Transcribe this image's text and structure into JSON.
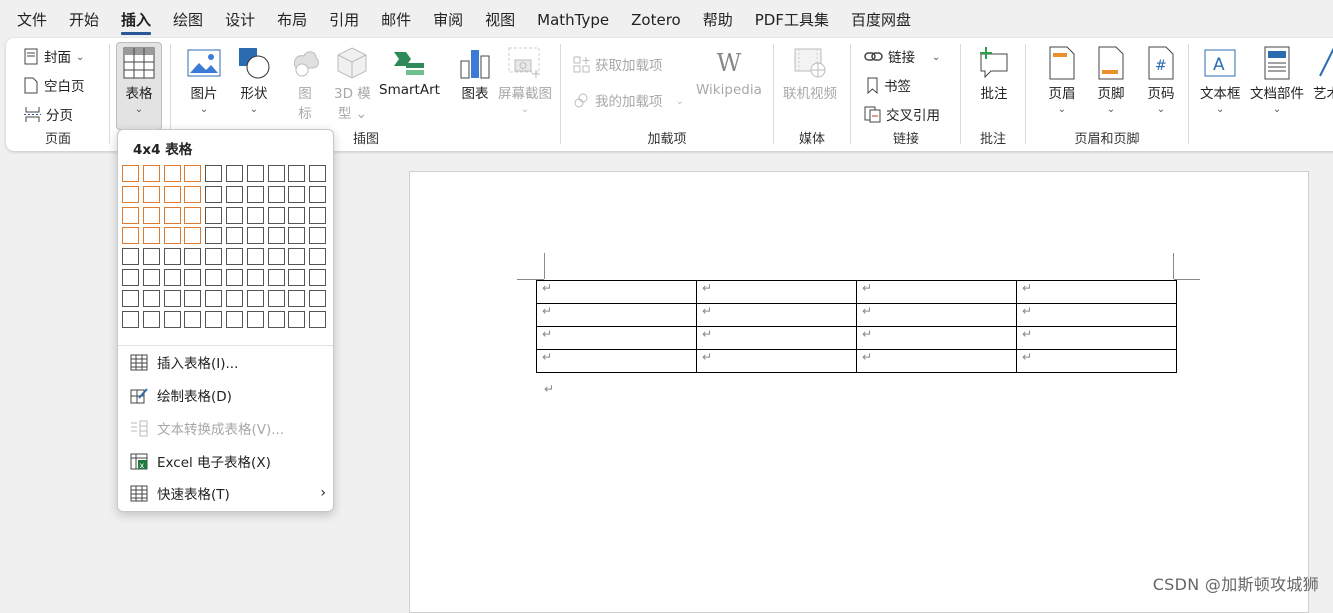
{
  "menubar": {
    "items": [
      "文件",
      "开始",
      "插入",
      "绘图",
      "设计",
      "布局",
      "引用",
      "邮件",
      "审阅",
      "视图",
      "MathType",
      "Zotero",
      "帮助",
      "PDF工具集",
      "百度网盘"
    ],
    "active_index": 2
  },
  "ribbon": {
    "pages_group": {
      "label": "页面",
      "cover": "封面",
      "blank": "空白页",
      "break": "分页"
    },
    "table_group": {
      "table": "表格"
    },
    "illustrations_group": {
      "label": "插图",
      "picture": "图片",
      "shapes": "形状",
      "icons_line1": "图",
      "icons_line2": "标",
      "model_line1": "3D 模",
      "model_line2": "型",
      "smartart": "SmartArt",
      "chart": "图表",
      "screenshot": "屏幕截图"
    },
    "addins_group": {
      "label": "加载项",
      "get_addins": "获取加载项",
      "my_addins": "我的加载项",
      "wikipedia": "Wikipedia"
    },
    "media_group": {
      "label": "媒体",
      "online_video": "联机视频"
    },
    "links_group": {
      "label": "链接",
      "link": "链接",
      "bookmark": "书签",
      "cross_ref": "交叉引用"
    },
    "comments_group": {
      "label": "批注",
      "comment": "批注"
    },
    "header_footer_group": {
      "label": "页眉和页脚",
      "header": "页眉",
      "footer": "页脚",
      "page_number": "页码"
    },
    "text_group": {
      "textbox": "文本框",
      "quick_parts": "文档部件",
      "wordart": "艺术字"
    }
  },
  "table_dropdown": {
    "title": "4x4 表格",
    "grid": {
      "columns": 10,
      "rows": 8,
      "selected_columns": 4,
      "selected_rows": 4
    },
    "items": [
      {
        "label": "插入表格(I)...",
        "disabled": false
      },
      {
        "label": "绘制表格(D)",
        "disabled": false
      },
      {
        "label": "文本转换成表格(V)...",
        "disabled": true
      },
      {
        "label": "Excel 电子表格(X)",
        "disabled": false
      },
      {
        "label": "快速表格(T)",
        "disabled": false
      }
    ]
  },
  "document": {
    "table": {
      "rows": 4,
      "columns": 4,
      "cell_mark": "↵"
    },
    "after_table_mark": "↵"
  },
  "colors": {
    "selected_cell_border": "#e07a2e",
    "active_tab_underline": "#2b579a"
  },
  "watermark": "CSDN @加斯顿攻城狮"
}
